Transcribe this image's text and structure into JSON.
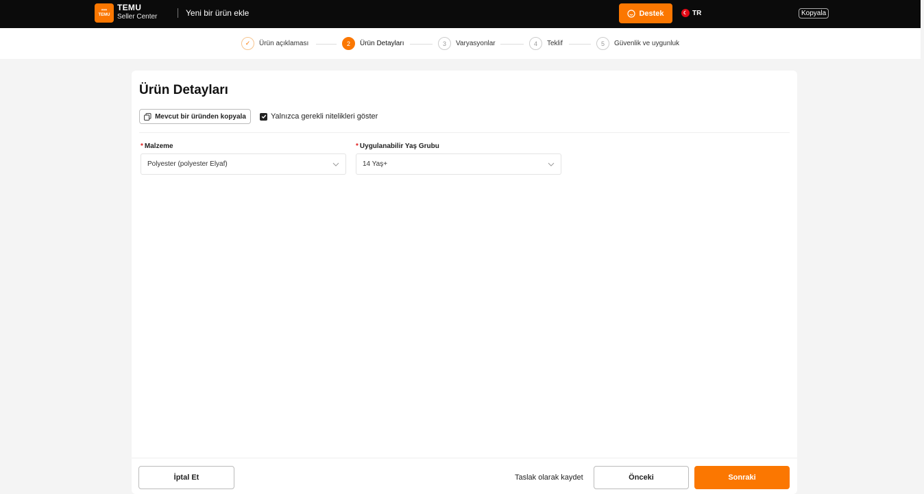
{
  "header": {
    "logo_text": [
      "∞∞",
      "TEMU"
    ],
    "brand_name": "TEMU",
    "brand_sub": "Seller Center",
    "page_title": "Yeni bir ürün ekle",
    "support_label": "Destek",
    "language": "TR",
    "copy_label": "Kopyala"
  },
  "stepper": {
    "steps": [
      {
        "number": "✓",
        "label": "Ürün açıklaması",
        "state": "done"
      },
      {
        "number": "2",
        "label": "Ürün Detayları",
        "state": "active"
      },
      {
        "number": "3",
        "label": "Varyasyonlar",
        "state": "pending"
      },
      {
        "number": "4",
        "label": "Teklif",
        "state": "pending"
      },
      {
        "number": "5",
        "label": "Güvenlik ve uygunluk",
        "state": "pending"
      }
    ]
  },
  "form": {
    "title": "Ürün Detayları",
    "copy_button": "Mevcut bir üründen kopyala",
    "required_only_label": "Yalnızca gerekli nitelikleri göster",
    "required_only_checked": true,
    "fields": [
      {
        "label": "Malzeme",
        "required": true,
        "value": "Polyester (polyester Elyaf)"
      },
      {
        "label": "Uygulanabilir Yaş Grubu",
        "required": true,
        "value": "14 Yaş+"
      }
    ]
  },
  "footer": {
    "cancel": "İptal Et",
    "save_draft": "Taslak olarak kaydet",
    "previous": "Önceki",
    "next": "Sonraki"
  },
  "colors": {
    "accent": "#fb7701",
    "topbar": "#0b0b0b",
    "background": "#f4f4f4",
    "required": "#e02020"
  }
}
